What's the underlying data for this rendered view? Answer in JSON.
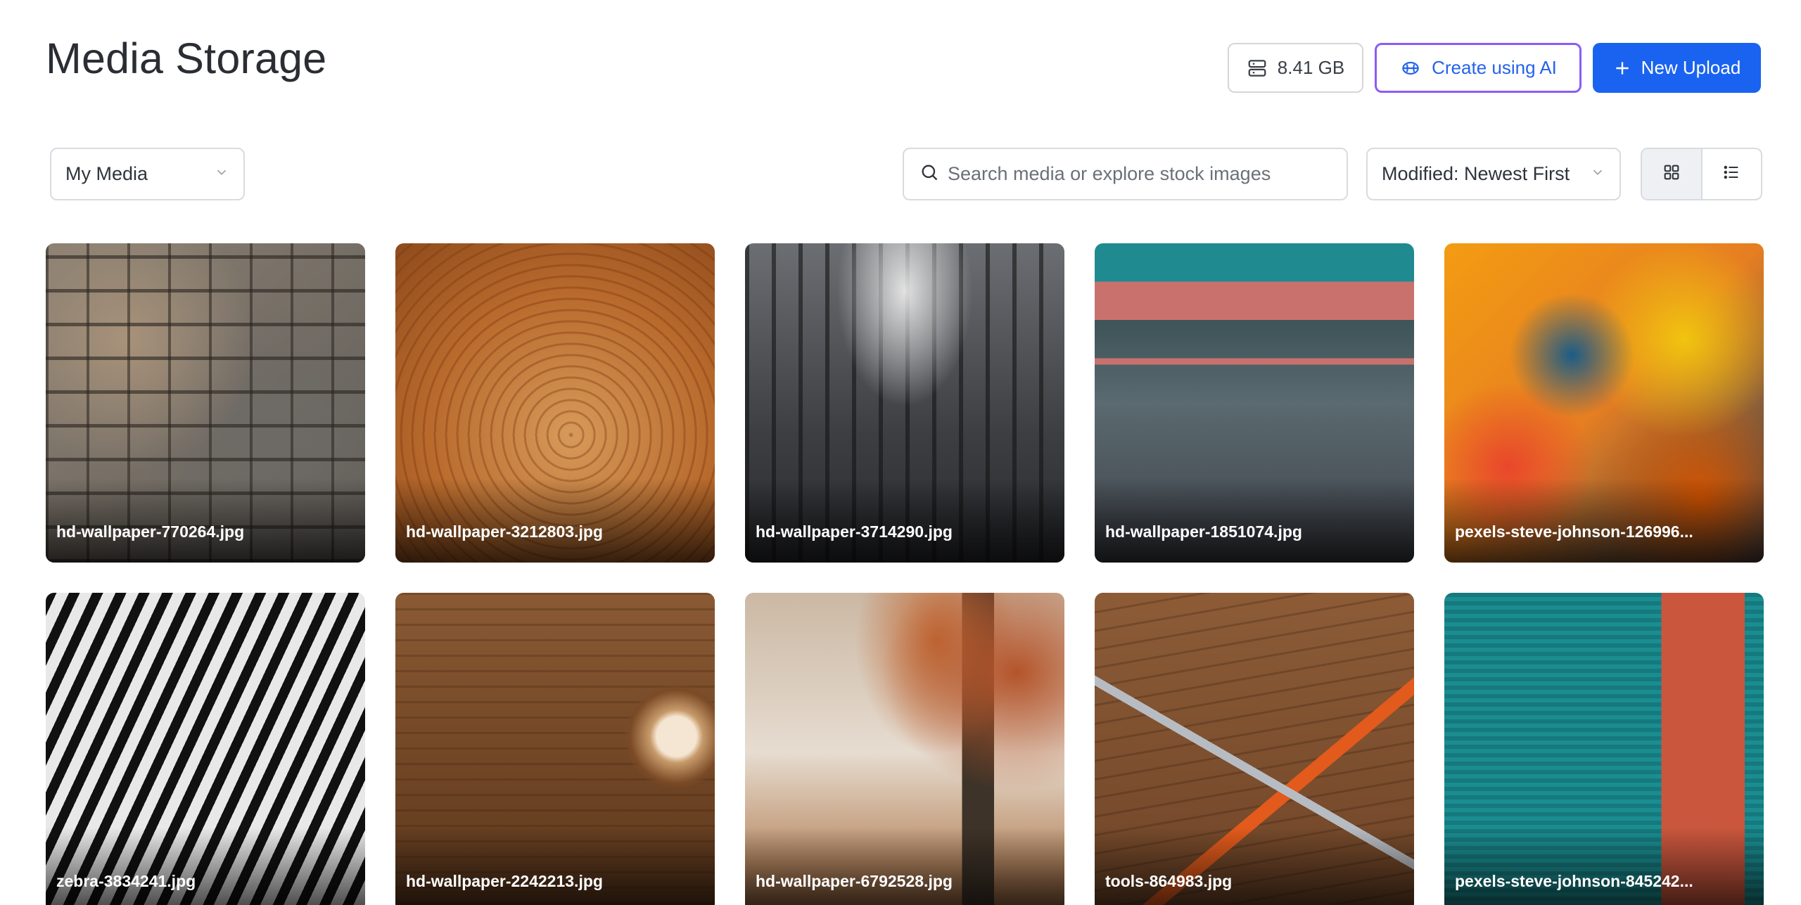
{
  "header": {
    "title": "Media Storage",
    "storage_label": "8.41 GB",
    "ai_label": "Create using AI",
    "upload_label": "New Upload"
  },
  "toolbar": {
    "media_filter": "My Media",
    "search_placeholder": "Search media or explore stock images",
    "sort_label": "Modified: Newest First",
    "active_view": "grid"
  },
  "colors": {
    "primary": "#1a63f0",
    "ai_border": "#8b5cf6",
    "ai_text": "#2563eb"
  },
  "media": [
    {
      "name": "hd-wallpaper-770264.jpg",
      "texture": "stone"
    },
    {
      "name": "hd-wallpaper-3212803.jpg",
      "texture": "wood"
    },
    {
      "name": "hd-wallpaper-3714290.jpg",
      "texture": "escalator"
    },
    {
      "name": "hd-wallpaper-1851074.jpg",
      "texture": "paint"
    },
    {
      "name": "pexels-steve-johnson-126996...",
      "texture": "abstract"
    },
    {
      "name": "zebra-3834241.jpg",
      "texture": "zebra"
    },
    {
      "name": "hd-wallpaper-2242213.jpg",
      "texture": "coffee"
    },
    {
      "name": "hd-wallpaper-6792528.jpg",
      "texture": "tree"
    },
    {
      "name": "tools-864983.jpg",
      "texture": "tools"
    },
    {
      "name": "pexels-steve-johnson-845242...",
      "texture": "door"
    }
  ]
}
